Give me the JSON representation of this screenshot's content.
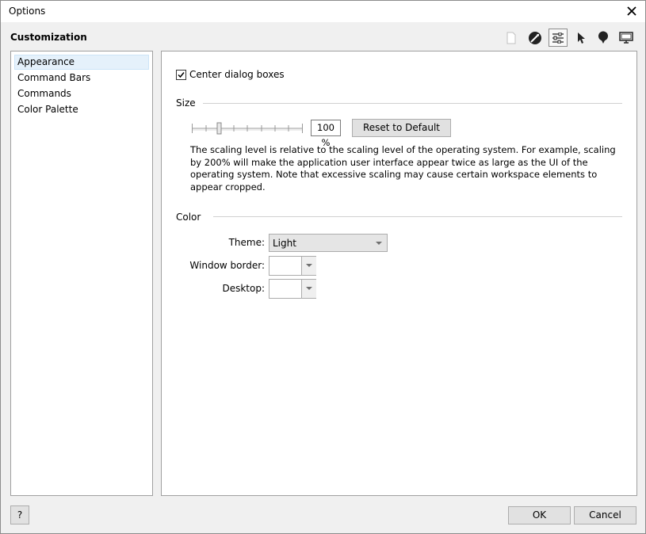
{
  "window": {
    "title": "Options"
  },
  "header": {
    "title": "Customization"
  },
  "category_icons": [
    "document-icon",
    "globe-pen-icon",
    "sliders-icon",
    "pointer-icon",
    "balloon-icon",
    "monitor-icon"
  ],
  "tree": {
    "items": [
      {
        "label": "Appearance",
        "selected": true
      },
      {
        "label": "Command Bars",
        "selected": false
      },
      {
        "label": "Commands",
        "selected": false
      },
      {
        "label": "Color Palette",
        "selected": false
      }
    ]
  },
  "appearance": {
    "center_dialogs_label": "Center dialog boxes",
    "center_dialogs_checked": true,
    "size": {
      "section_label": "Size",
      "scaling_value": "100 %",
      "reset_label": "Reset to Default",
      "description": "The scaling level is relative to the scaling level of the operating system. For example, scaling by 200% will make the application user interface appear twice as large as the UI of the operating system. Note that excessive scaling may cause certain workspace elements to appear cropped."
    },
    "color": {
      "section_label": "Color",
      "theme_label": "Theme:",
      "theme_value": "Light",
      "window_border_label": "Window border:",
      "desktop_label": "Desktop:"
    }
  },
  "footer": {
    "help_label": "?",
    "ok_label": "OK",
    "cancel_label": "Cancel"
  }
}
